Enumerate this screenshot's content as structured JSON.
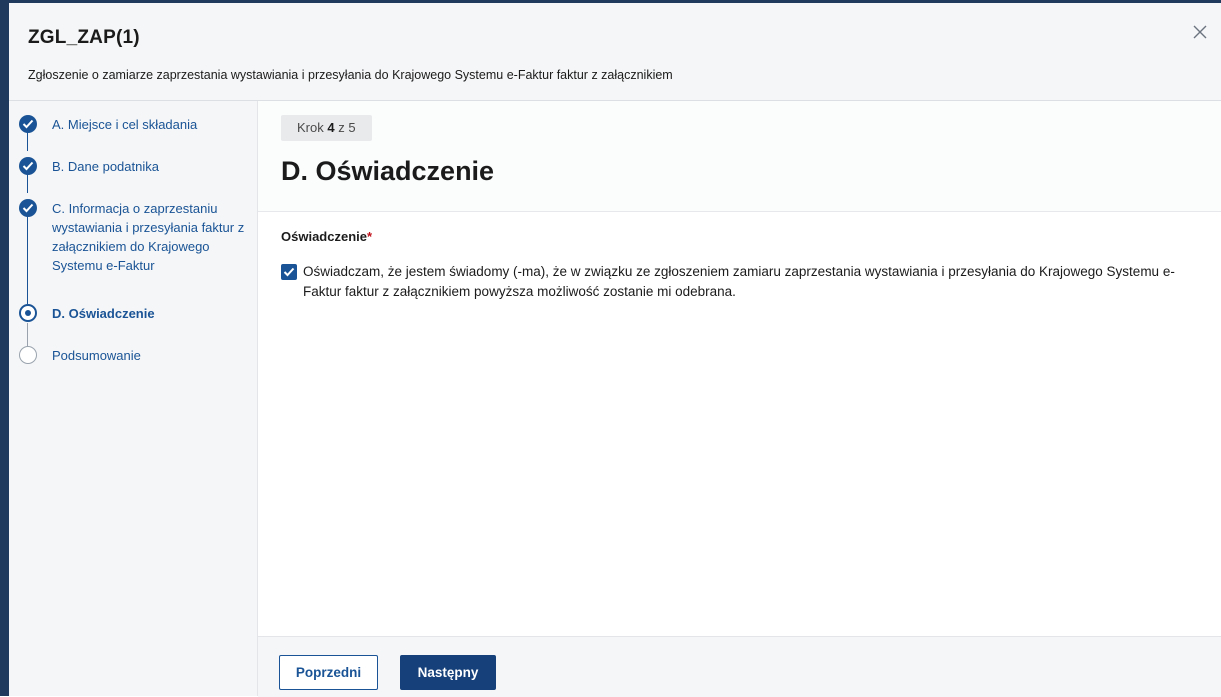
{
  "header": {
    "title": "ZGL_ZAP(1)",
    "subtitle": "Zgłoszenie o zamiarze zaprzestania wystawiania i przesyłania do Krajowego Systemu e-Faktur faktur z załącznikiem",
    "close_icon": "close-icon"
  },
  "sidebar": {
    "steps": [
      {
        "label": "A. Miejsce i cel składania",
        "state": "done"
      },
      {
        "label": "B. Dane podatnika",
        "state": "done"
      },
      {
        "label": "C. Informacja o zaprzestaniu wystawiania i przesyłania faktur z załącznikiem do Krajowego Systemu e-Faktur",
        "state": "done"
      },
      {
        "label": "D. Oświadczenie",
        "state": "current"
      },
      {
        "label": "Podsumowanie",
        "state": "todo"
      }
    ]
  },
  "main": {
    "step_prefix": "Krok",
    "step_current": "4",
    "step_suffix": "z 5",
    "section_title": "D. Oświadczenie",
    "field_label": "Oświadczenie",
    "required_mark": "*",
    "checkbox_checked": true,
    "checkbox_text": "Oświadczam, że jestem świadomy (-ma), że w związku ze zgłoszeniem zamiaru zaprzestania wystawiania i przesyłania do Krajowego Systemu e-Faktur faktur z załącznikiem powyższa możliwość zostanie mi odebrana."
  },
  "footer": {
    "prev_label": "Poprzedni",
    "next_label": "Następny"
  },
  "colors": {
    "accent": "#1a5496",
    "primary_button": "#16407a",
    "required": "#c0101a",
    "frame": "#1f3a5c"
  }
}
